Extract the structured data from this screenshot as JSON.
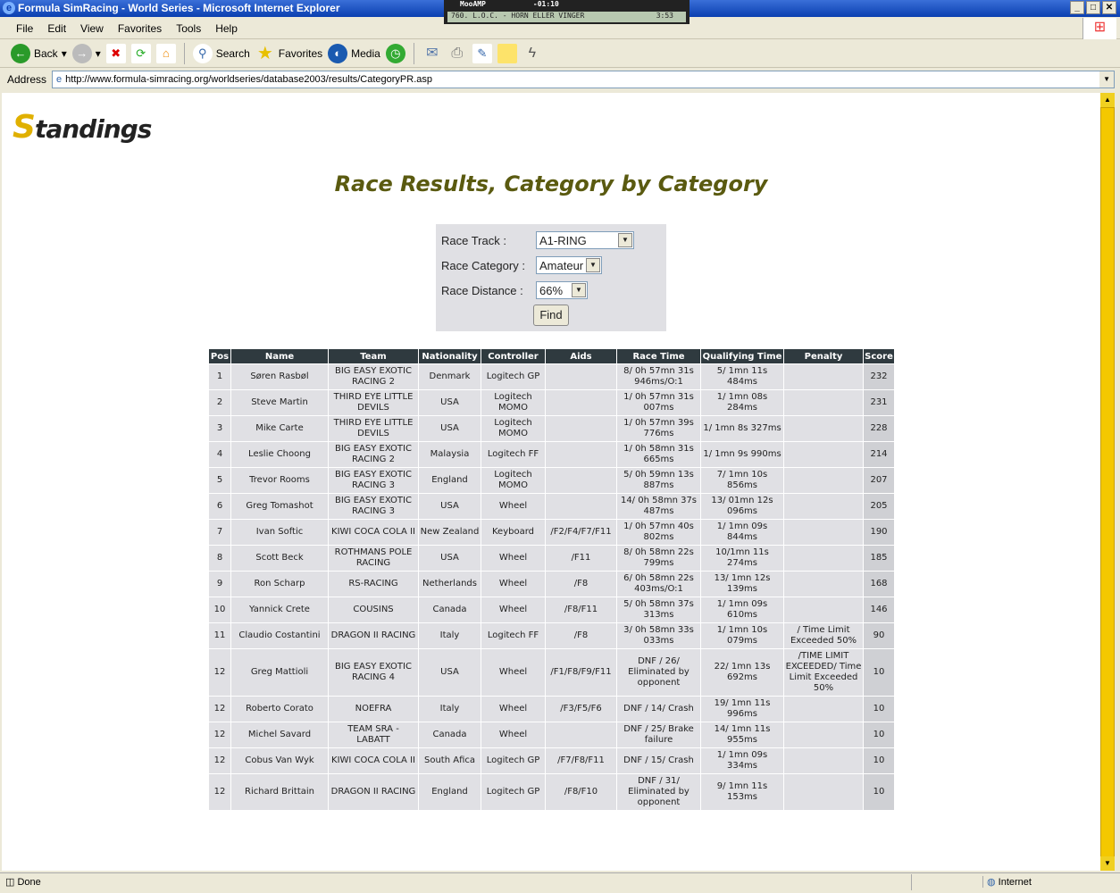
{
  "window": {
    "title": "Formula SimRacing - World Series - Microsoft Internet Explorer"
  },
  "mooamp": {
    "name": "MooAMP",
    "time": "-01:10",
    "track": "760. L.O.C. - HORN ELLER VINGER",
    "length": "3:53"
  },
  "menu": [
    "File",
    "Edit",
    "View",
    "Favorites",
    "Tools",
    "Help"
  ],
  "toolbar": {
    "back": "Back",
    "search": "Search",
    "favorites": "Favorites",
    "media": "Media"
  },
  "address": {
    "label": "Address",
    "url": "http://www.formula-simracing.org/worldseries/database2003/results/CategoryPR.asp"
  },
  "page": {
    "logo": "Standings",
    "title": "Race Results, Category by Category"
  },
  "form": {
    "track_label": "Race Track :",
    "track_value": "A1-RING",
    "category_label": "Race Category :",
    "category_value": "Amateur",
    "distance_label": "Race Distance :",
    "distance_value": "66%",
    "find": "Find"
  },
  "table": {
    "headers": [
      "Pos",
      "Name",
      "Team",
      "Nationality",
      "Controller",
      "Aids",
      "Race Time",
      "Qualifying Time",
      "Penalty",
      "Score"
    ],
    "rows": [
      [
        "1",
        "Søren Rasbøl",
        "BIG EASY EXOTIC RACING 2",
        "Denmark",
        "Logitech GP",
        "",
        "8/ 0h 57mn 31s 946ms/O:1",
        "5/ 1mn 11s 484ms",
        "",
        "232"
      ],
      [
        "2",
        "Steve Martin",
        "THIRD EYE LITTLE DEVILS",
        "USA",
        "Logitech MOMO",
        "",
        "1/ 0h 57mn 31s 007ms",
        "1/ 1mn 08s 284ms",
        "",
        "231"
      ],
      [
        "3",
        "Mike Carte",
        "THIRD EYE LITTLE DEVILS",
        "USA",
        "Logitech MOMO",
        "",
        "1/ 0h 57mn 39s 776ms",
        "1/ 1mn 8s 327ms",
        "",
        "228"
      ],
      [
        "4",
        "Leslie Choong",
        "BIG EASY EXOTIC RACING 2",
        "Malaysia",
        "Logitech FF",
        "",
        "1/ 0h 58mn 31s 665ms",
        "1/ 1mn 9s 990ms",
        "",
        "214"
      ],
      [
        "5",
        "Trevor Rooms",
        "BIG EASY EXOTIC RACING 3",
        "England",
        "Logitech MOMO",
        "",
        "5/ 0h 59mn 13s 887ms",
        "7/ 1mn 10s 856ms",
        "",
        "207"
      ],
      [
        "6",
        "Greg Tomashot",
        "BIG EASY EXOTIC RACING 3",
        "USA",
        "Wheel",
        "",
        "14/ 0h 58mn 37s 487ms",
        "13/ 01mn 12s 096ms",
        "",
        "205"
      ],
      [
        "7",
        "Ivan Softic",
        "KIWI COCA COLA II",
        "New Zealand",
        "Keyboard",
        "/F2/F4/F7/F11",
        "1/ 0h 57mn 40s 802ms",
        "1/ 1mn 09s 844ms",
        "",
        "190"
      ],
      [
        "8",
        "Scott  Beck",
        "ROTHMANS POLE RACING",
        "USA",
        "Wheel",
        "/F11",
        "8/ 0h 58mn 22s 799ms",
        "10/1mn 11s 274ms",
        "",
        "185"
      ],
      [
        "9",
        "Ron Scharp",
        "RS-RACING",
        "Netherlands",
        "Wheel",
        "/F8",
        "6/ 0h 58mn 22s 403ms/O:1",
        "13/ 1mn 12s 139ms",
        "",
        "168"
      ],
      [
        "10",
        "Yannick Crete",
        "COUSINS",
        "Canada",
        "Wheel",
        "/F8/F11",
        "5/ 0h 58mn 37s 313ms",
        "1/ 1mn 09s 610ms",
        "",
        "146"
      ],
      [
        "11",
        "Claudio Costantini",
        "DRAGON II RACING",
        "Italy",
        "Logitech FF",
        "/F8",
        "3/ 0h 58mn 33s 033ms",
        "1/ 1mn 10s 079ms",
        "/ Time Limit Exceeded 50%",
        "90"
      ],
      [
        "12",
        "Greg Mattioli",
        "BIG EASY EXOTIC RACING 4",
        "USA",
        "Wheel",
        "/F1/F8/F9/F11",
        "DNF / 26/ Eliminated by opponent",
        "22/ 1mn 13s 692ms",
        "/TIME LIMIT EXCEEDED/ Time Limit Exceeded 50%",
        "10"
      ],
      [
        "12",
        "Roberto Corato",
        "NOEFRA",
        "Italy",
        "Wheel",
        "/F3/F5/F6",
        "DNF / 14/ Crash",
        "19/ 1mn 11s 996ms",
        "",
        "10"
      ],
      [
        "12",
        "Michel Savard",
        "TEAM SRA - LABATT",
        "Canada",
        "Wheel",
        "",
        "DNF / 25/ Brake failure",
        "14/ 1mn 11s 955ms",
        "",
        "10"
      ],
      [
        "12",
        "Cobus Van Wyk",
        "KIWI COCA COLA II",
        "South Afica",
        "Logitech GP",
        "/F7/F8/F11",
        "DNF / 15/ Crash",
        "1/ 1mn 09s 334ms",
        "",
        "10"
      ],
      [
        "12",
        "Richard Brittain",
        "DRAGON II RACING",
        "England",
        "Logitech GP",
        "/F8/F10",
        "DNF / 31/ Eliminated by opponent",
        "9/ 1mn 11s 153ms",
        "",
        "10"
      ]
    ]
  },
  "status": {
    "text": "Done",
    "zone": "Internet"
  }
}
